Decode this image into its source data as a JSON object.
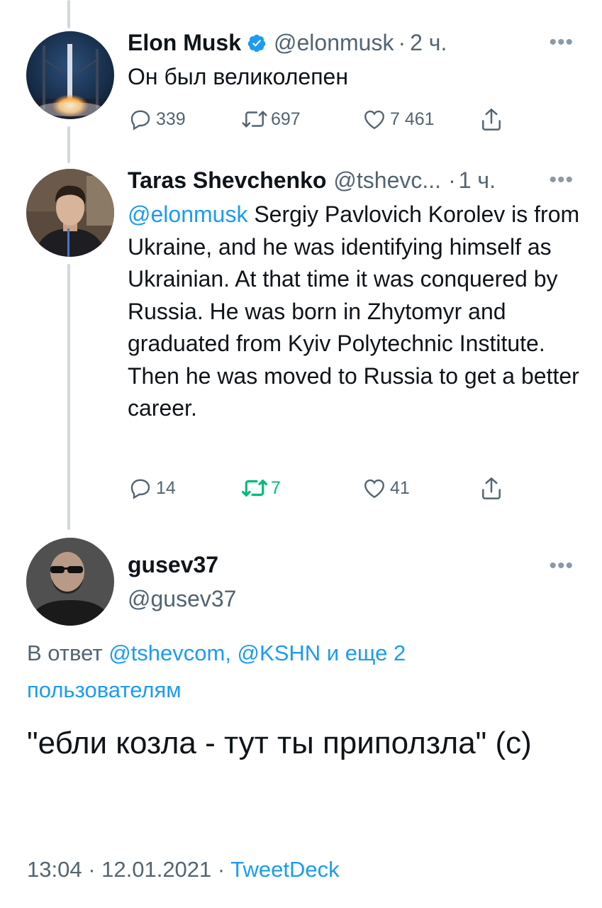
{
  "tweet1": {
    "name": "Elon Musk",
    "verified_icon": "verified-badge-icon",
    "handle": "@elonmusk",
    "time": "2 ч.",
    "text": "Он был великолепен",
    "replies": "339",
    "retweets": "697",
    "likes": "7 461"
  },
  "tweet2": {
    "name": "Taras Shevchenko",
    "handle": "@tshevc...",
    "time": "1 ч.",
    "mention": "@elonmusk",
    "text": " Sergiy Pavlovich Korolev is from Ukraine, and he was identifying himself as Ukrainian. At that time it was conquered by Russia. He was born in Zhytomyr and graduated from Kyiv Polytechnic Institute. Then he was moved to Russia to get a better career.",
    "replies": "14",
    "retweets": "7",
    "likes": "41"
  },
  "tweet3": {
    "name": "gusev37",
    "handle": "@gusev37",
    "reply_prefix": "В ответ ",
    "reply_targets": "@tshevcom, @KSHN и еще 2 пользователям",
    "text": "\"ебли козла - тут ты приползла\" (с)",
    "timestamp": "13:04 · 12.01.2021 · ",
    "source": "TweetDeck"
  },
  "separator": "·",
  "more_icon": "more-dots-icon",
  "colors": {
    "accent": "#1d9bf0",
    "retweet_active": "#00ba7c",
    "muted": "#536471",
    "thread_line": "#cfd9de"
  }
}
